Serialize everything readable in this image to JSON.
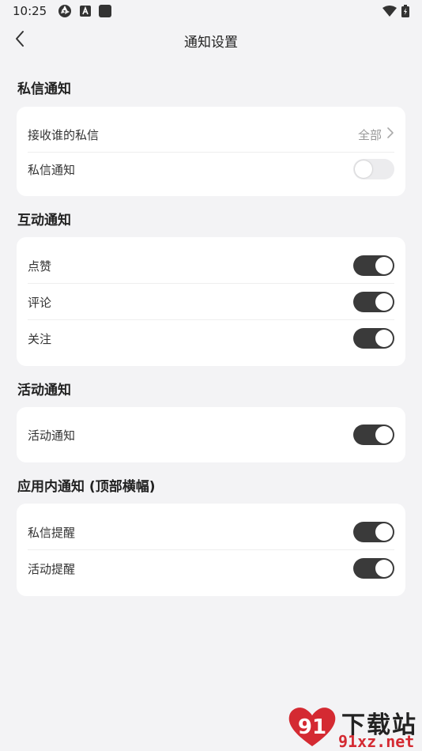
{
  "status_bar": {
    "time": "10:25"
  },
  "header": {
    "title": "通知设置"
  },
  "sections": {
    "private_message": {
      "title": "私信通知",
      "rows": [
        {
          "label": "接收谁的私信",
          "value": "全部"
        },
        {
          "label": "私信通知",
          "state": false
        }
      ]
    },
    "interaction": {
      "title": "互动通知",
      "rows": [
        {
          "label": "点赞",
          "state": true
        },
        {
          "label": "评论",
          "state": true
        },
        {
          "label": "关注",
          "state": true
        }
      ]
    },
    "activity": {
      "title": "活动通知",
      "rows": [
        {
          "label": "活动通知",
          "state": true
        }
      ]
    },
    "in_app": {
      "title": "应用内通知 (顶部横幅)",
      "rows": [
        {
          "label": "私信提醒",
          "state": true
        },
        {
          "label": "活动提醒",
          "state": true
        }
      ]
    }
  },
  "watermark": {
    "brand_cn": "下载站",
    "url": "91xz.net",
    "logo_text": "91"
  },
  "colors": {
    "background": "#f3f3f5",
    "card": "#ffffff",
    "toggle_on": "#3a3a3a",
    "toggle_off": "#ececee",
    "watermark_red": "#d42a32"
  }
}
